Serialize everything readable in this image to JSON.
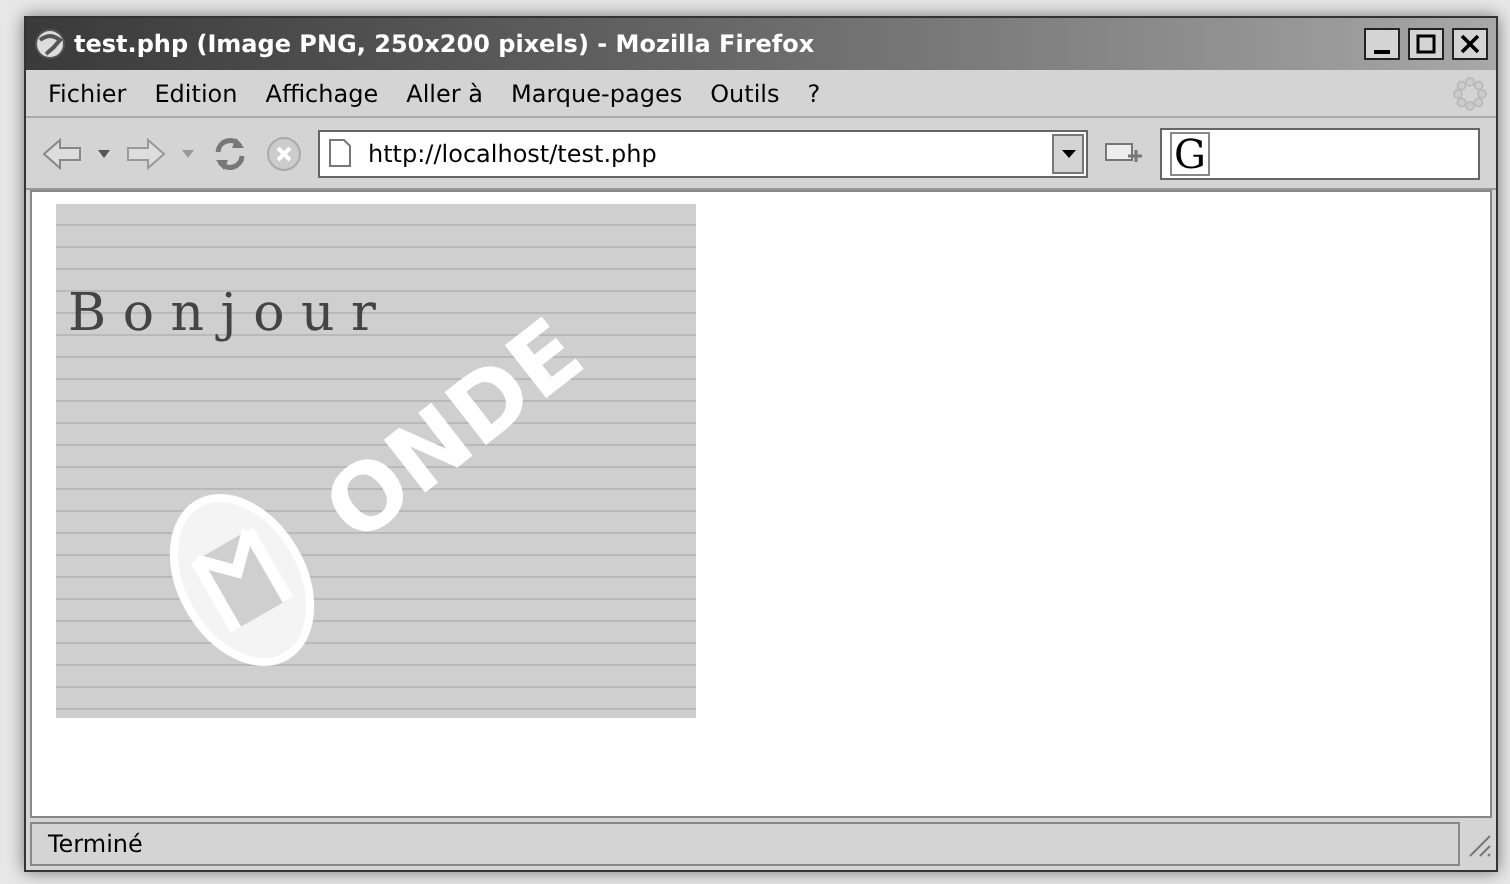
{
  "window": {
    "title": "test.php (Image PNG, 250x200 pixels) - Mozilla Firefox"
  },
  "menu": [
    "Fichier",
    "Edition",
    "Affichage",
    "Aller à",
    "Marque-pages",
    "Outils",
    "?"
  ],
  "toolbar": {
    "address": "http://localhost/test.php",
    "search_logo": "G"
  },
  "image": {
    "texts": [
      "B o n j o u r",
      "ONDE"
    ]
  },
  "status_bar": {
    "text": "Terminé"
  }
}
